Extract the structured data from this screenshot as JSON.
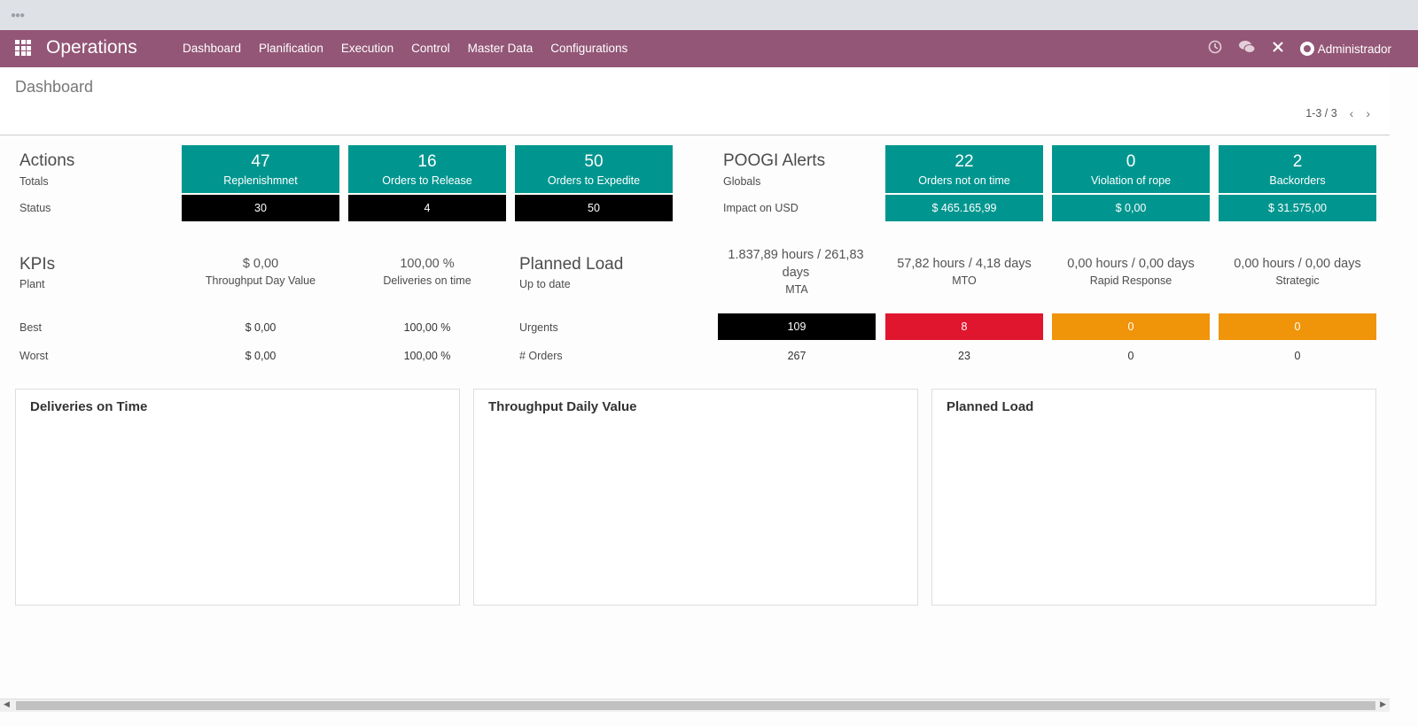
{
  "navbar": {
    "app_title": "Operations",
    "menu": [
      "Dashboard",
      "Planification",
      "Execution",
      "Control",
      "Master Data",
      "Configurations"
    ],
    "user": "Administrador",
    "icons": [
      "clock-icon",
      "chat-icon",
      "close-icon"
    ]
  },
  "control_panel": {
    "breadcrumb": "Dashboard",
    "pager": "1-3 / 3"
  },
  "actions": {
    "title": "Actions",
    "totals_label": "Totals",
    "status_label": "Status",
    "tiles": [
      {
        "value": "47",
        "label": "Replenishmnet",
        "status": "30"
      },
      {
        "value": "16",
        "label": "Orders to Release",
        "status": "4"
      },
      {
        "value": "50",
        "label": "Orders to Expedite",
        "status": "50"
      }
    ]
  },
  "poogi": {
    "title": "POOGI Alerts",
    "globals_label": "Globals",
    "impact_label": "Impact on USD",
    "tiles": [
      {
        "value": "22",
        "label": "Orders not on time",
        "impact": "$ 465.165,99"
      },
      {
        "value": "0",
        "label": "Violation of rope",
        "impact": "$ 0,00"
      },
      {
        "value": "2",
        "label": "Backorders",
        "impact": "$ 31.575,00"
      }
    ]
  },
  "kpis": {
    "title": "KPIs",
    "plant_label": "Plant",
    "best_label": "Best",
    "worst_label": "Worst",
    "columns": [
      {
        "value": "$ 0,00",
        "label": "Throughput Day Value",
        "best": "$ 0,00",
        "worst": "$ 0,00"
      },
      {
        "value": "100,00 %",
        "label": "Deliveries on time",
        "best": "100,00 %",
        "worst": "100,00 %"
      }
    ]
  },
  "planned_load": {
    "title": "Planned Load",
    "subtitle": "Up to date",
    "urgents_label": "Urgents",
    "orders_label": "# Orders",
    "columns": [
      {
        "value_line1": "1.837,89 hours / 261,83",
        "value_line2": "days",
        "label": "MTA",
        "urgents": "109",
        "orders": "267",
        "color": "#000000"
      },
      {
        "value_line1": "57,82 hours / 4,18 days",
        "value_line2": "",
        "label": "MTO",
        "urgents": "8",
        "orders": "23",
        "color": "#e0162e"
      },
      {
        "value_line1": "0,00 hours / 0,00 days",
        "value_line2": "",
        "label": "Rapid Response",
        "urgents": "0",
        "orders": "0",
        "color": "#f0940a"
      },
      {
        "value_line1": "0,00 hours / 0,00 days",
        "value_line2": "",
        "label": "Strategic",
        "urgents": "0",
        "orders": "0",
        "color": "#f0940a"
      }
    ]
  },
  "panels": [
    {
      "title": "Deliveries on Time"
    },
    {
      "title": "Throughput Daily Value"
    },
    {
      "title": "Planned Load"
    }
  ],
  "colors": {
    "navbar": "#935676",
    "tile": "#00968f",
    "status": "#000000"
  }
}
